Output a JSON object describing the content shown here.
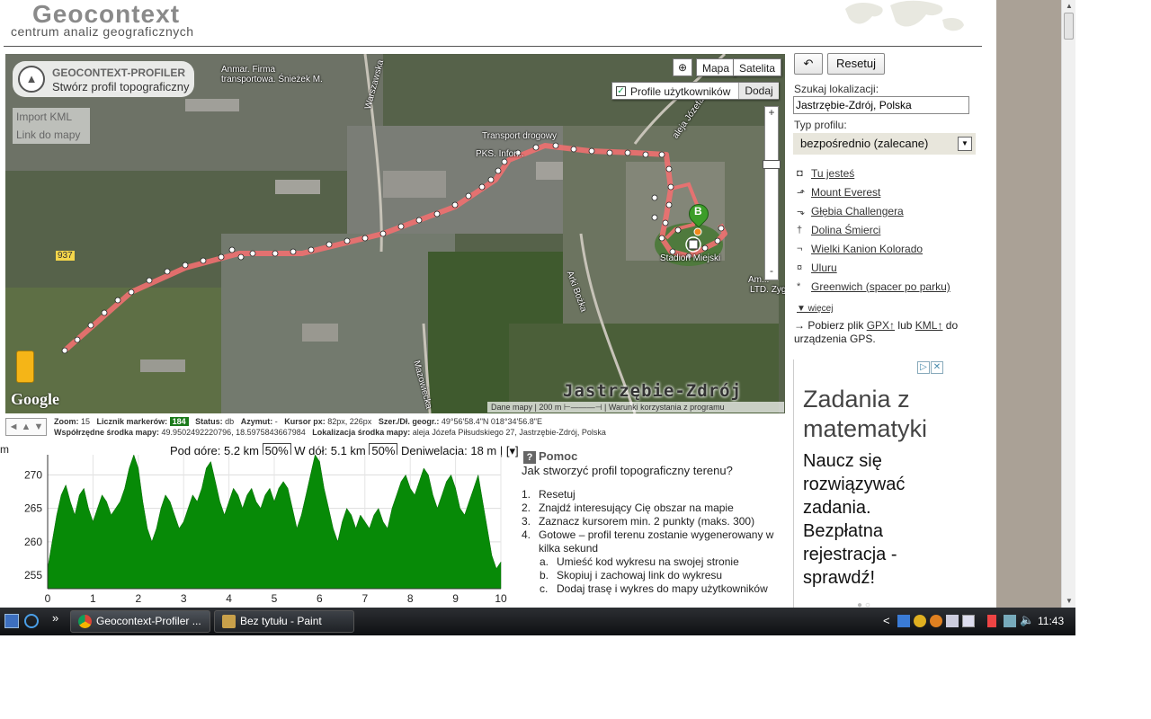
{
  "header": {
    "logo_title": "Geocontext",
    "logo_subtitle": "centrum analiz geograficznych"
  },
  "map": {
    "badge_title": "GEOCONTEXT-PROFILER",
    "badge_subtitle": "Stwórz profil topograficzny",
    "import_kml": "Import KML",
    "link_to_map": "Link do mapy",
    "zoom_tool_glyph": "⊕",
    "type_map": "Mapa",
    "type_satellite": "Satelita",
    "user_profiles_label": "Profile użytkowników",
    "user_profiles_checked": true,
    "add_label": "Dodaj",
    "zoom_in": "+",
    "zoom_out": "-",
    "google": "Google",
    "city": "Jastrzębie-Zdrój",
    "copyright": "Dane mapy | 200 m  ⊢———⊣  | Warunki korzystania z programu",
    "labels": {
      "firm": "Anmar. Firma",
      "firm2": "transportowa. Śnieżek M.",
      "warszawska": "Warszawska",
      "transport": "Transport drogowy",
      "pks": "PKS. Infor...",
      "aleja": "aleja Józefa...",
      "road": "937",
      "boczka": "Arki Bożka",
      "mazowiecka": "Mazowiecka",
      "stadion": "Stadion Miejski",
      "ltd": "LTD. Zyg...",
      "am": "Am...",
      "marker_b": "B"
    }
  },
  "status": {
    "nav_arrows": "◄ ▲ ▼",
    "zoom_label": "Zoom:",
    "zoom_value": "15",
    "markers_label": "Licznik markerów:",
    "markers_value": "184",
    "status_label": "Status:",
    "status_value": "db",
    "azimuth_label": "Azymut:",
    "azimuth_value": "-",
    "cursor_label": "Kursor px:",
    "cursor_value": "82px, 226px",
    "latlng_label": "Szer./Dł. geogr.:",
    "latlng_value": "49°56'58.4\"N 018°34'56.8\"E",
    "center_label": "Współrzędne środka mapy:",
    "center_value": "49.9502492220796, 18.5975843667984",
    "location_label": "Lokalizacja środka mapy:",
    "location_value": "aleja Józefa Piłsudskiego 27, Jastrzębie-Zdrój, Polska"
  },
  "chart_head": {
    "up_label": "Pod górę: 5,2 km",
    "up_pct": "50%",
    "down_label": "W dół: 5,1 km",
    "down_pct": "50%",
    "elev_label": "Deniwelacja: 18 m | [",
    "menu": "▾",
    "end": "]"
  },
  "chart_data": {
    "type": "area",
    "ylabel": "m",
    "ylim": [
      253,
      273
    ],
    "yticks": [
      255,
      260,
      265,
      270
    ],
    "xlim": [
      0,
      10
    ],
    "xticks": [
      0,
      1,
      2,
      3,
      4,
      5,
      6,
      7,
      8,
      9,
      10
    ],
    "grid": true,
    "color": "#078a07",
    "x": [
      0,
      0.1,
      0.2,
      0.3,
      0.4,
      0.5,
      0.6,
      0.7,
      0.8,
      0.9,
      1.0,
      1.1,
      1.2,
      1.3,
      1.4,
      1.5,
      1.6,
      1.7,
      1.8,
      1.9,
      2.0,
      2.1,
      2.2,
      2.3,
      2.4,
      2.5,
      2.6,
      2.7,
      2.8,
      2.9,
      3.0,
      3.1,
      3.2,
      3.3,
      3.4,
      3.5,
      3.6,
      3.7,
      3.8,
      3.9,
      4.0,
      4.1,
      4.2,
      4.3,
      4.4,
      4.5,
      4.6,
      4.7,
      4.8,
      4.9,
      5.0,
      5.1,
      5.2,
      5.3,
      5.4,
      5.5,
      5.6,
      5.7,
      5.8,
      5.9,
      6.0,
      6.1,
      6.2,
      6.3,
      6.4,
      6.5,
      6.6,
      6.7,
      6.8,
      6.9,
      7.0,
      7.1,
      7.2,
      7.3,
      7.4,
      7.5,
      7.6,
      7.7,
      7.8,
      7.9,
      8.0,
      8.1,
      8.2,
      8.3,
      8.4,
      8.5,
      8.6,
      8.7,
      8.8,
      8.9,
      9.0,
      9.1,
      9.2,
      9.3,
      9.4,
      9.5,
      9.6,
      9.7,
      9.8,
      9.9,
      10.0
    ],
    "y": [
      256,
      260,
      264,
      267,
      268.5,
      266,
      264,
      267,
      268,
      265,
      263,
      265,
      267,
      266,
      264,
      265,
      266,
      268,
      271,
      273,
      271,
      266,
      262,
      260,
      262,
      265,
      267,
      266,
      264,
      262,
      263,
      265,
      267,
      266,
      268,
      271,
      272,
      269,
      266,
      264,
      266,
      268,
      267,
      265,
      267,
      268,
      266,
      265,
      267,
      268,
      266,
      268,
      269,
      268,
      265,
      262,
      264,
      267,
      270,
      273,
      272,
      268,
      265,
      262,
      260,
      263,
      265,
      264,
      262,
      264,
      263,
      262,
      264,
      265,
      263,
      262,
      265,
      267,
      269,
      270,
      268,
      267,
      269,
      271,
      270,
      267,
      265,
      267,
      269,
      270,
      268,
      265,
      264,
      266,
      268,
      270,
      266,
      262,
      258,
      256,
      257
    ]
  },
  "help": {
    "icon": "?",
    "title": "Pomoc",
    "question": "Jak stworzyć profil topograficzny terenu?",
    "steps": [
      {
        "n": "1.",
        "text": "Resetuj"
      },
      {
        "n": "2.",
        "text": "Znajdź interesujący Cię obszar na mapie"
      },
      {
        "n": "3.",
        "text": "Zaznacz kursorem min. 2 punkty (maks. 300)"
      },
      {
        "n": "4.",
        "text": "Gotowe – profil terenu zostanie wygenerowany w kilka sekund"
      }
    ],
    "substeps": [
      {
        "n": "a.",
        "text": "Umieść kod wykresu na swojej stronie"
      },
      {
        "n": "b.",
        "text": "Skopiuj i zachowaj link do wykresu"
      },
      {
        "n": "c.",
        "text": "Dodaj trasę i wykres do mapy użytkowników"
      }
    ]
  },
  "sidebar": {
    "undo_glyph": "↶",
    "reset_label": "Resetuj",
    "search_label": "Szukaj lokalizacji:",
    "search_value": "Jastrzębie-Zdrój, Polska",
    "profile_type_label": "Typ profilu:",
    "profile_type_value": "bezpośrednio (zalecane)",
    "locations": [
      {
        "icon": "◘",
        "label": "Tu jesteś"
      },
      {
        "icon": "⬏",
        "label": "Mount Everest"
      },
      {
        "icon": "⬎",
        "label": "Głębia Challengera"
      },
      {
        "icon": "†",
        "label": "Dolina Śmierci"
      },
      {
        "icon": "¬",
        "label": "Wielki Kanion Kolorado"
      },
      {
        "icon": "¤",
        "label": "Uluru"
      },
      {
        "icon": "*",
        "label": "Greenwich (spacer po parku)"
      }
    ],
    "more_label": "▼ więcej",
    "gpx_prefix": "→ Pobierz plik",
    "gpx_link": "GPX↑",
    "gpx_mid": "lub",
    "kml_link": "KML↑",
    "gpx_suffix": "do urządzenia GPS."
  },
  "ad": {
    "title": "Zadania z matematyki",
    "body": "Naucz się rozwiązywać zadania. Bezpłatna rejestracja - sprawdź!",
    "icon_info": "▷",
    "icon_close": "✕"
  },
  "taskbar": {
    "start_more": "»",
    "task1": "Geocontext-Profiler ...",
    "task2": "Bez tytułu - Paint",
    "tray_arrow": "<",
    "clock": "11:43"
  },
  "colors": {
    "route": "#f07070",
    "chart_fill": "#078a07",
    "ad_border": "#cccccc"
  }
}
